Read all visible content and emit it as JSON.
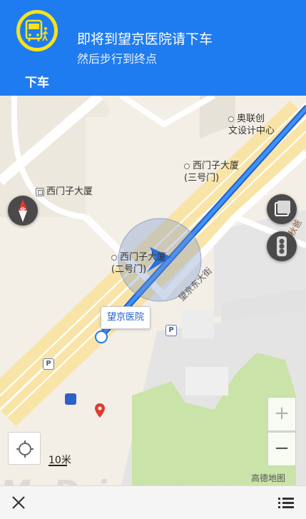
{
  "header": {
    "step_label": "下车",
    "instruction_main": "即将到望京医院请下车",
    "instruction_sub": "然后步行到终点",
    "icon": "bus-alight-icon"
  },
  "map": {
    "compass_label": "北",
    "pois": {
      "aolian": "奥联创\n文设计中心",
      "ximenzi_3": "西门子大厦\n(三号门)",
      "ximenzi_building": "西门子大厦",
      "ximenzi_2": "西门子大厦\n(二号门)",
      "road_main": "望京东大街",
      "road_right": "宏秋爸"
    },
    "destination_label": "望京医院",
    "scale": "10米",
    "brand": "高德地图",
    "zoom_in": "+",
    "zoom_out": "−"
  },
  "watermark": "MyDrivers.com",
  "colors": {
    "header_bg": "#1f7cf0",
    "route": "#2a7de1",
    "bus_icon_ring": "#f7e21c"
  }
}
